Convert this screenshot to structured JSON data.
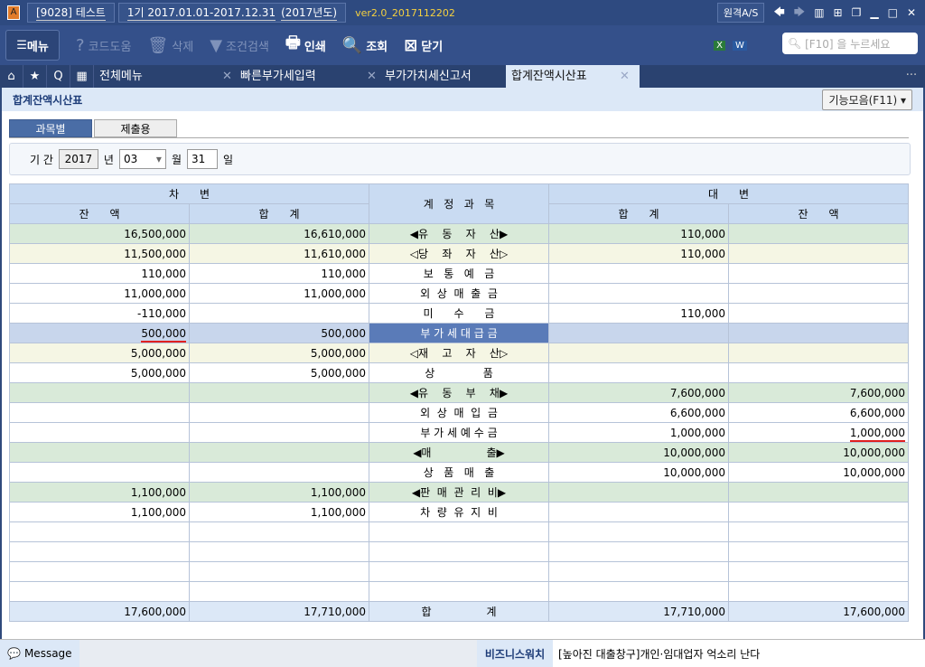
{
  "titlebar": {
    "app_icon": "A",
    "company": "[9028] 테스트",
    "period": "1기 2017.01.01-2017.12.31",
    "year": "(2017년도)",
    "version": "ver2.0_2017112202",
    "remote": "원격A/S"
  },
  "toolbar": {
    "menu": "메뉴",
    "help": "코드도움",
    "delete": "삭제",
    "filter": "조건검색",
    "print": "인쇄",
    "query": "조회",
    "close": "닫기",
    "search_placeholder": "[F10] 을 누르세요"
  },
  "tabs": {
    "all_menu": "전체메뉴",
    "items": [
      "빠른부가세입력",
      "부가가치세신고서",
      "합계잔액시산표"
    ],
    "more": "..."
  },
  "page": {
    "title": "합계잔액시산표",
    "function_menu": "기능모음(F11)",
    "subtabs": [
      "과목별",
      "제출용"
    ],
    "period_label": "기 간",
    "year": "2017",
    "year_unit": "년",
    "month": "03",
    "month_unit": "월",
    "day": "31",
    "day_unit": "일"
  },
  "table": {
    "debit": "차      변",
    "credit": "대      변",
    "account": "계   정   과   목",
    "balance": "잔      액",
    "total": "합      계",
    "rows": [
      {
        "t": "g",
        "d1": "16,500,000",
        "d2": "16,610,000",
        "a": "◀유    동    자    산▶",
        "c1": "110,000",
        "c2": ""
      },
      {
        "t": "y",
        "d1": "11,500,000",
        "d2": "11,610,000",
        "a": "◁당    좌    자    산▷",
        "c1": "110,000",
        "c2": ""
      },
      {
        "t": "w",
        "d1": "110,000",
        "d2": "110,000",
        "a": "보   통   예   금",
        "c1": "",
        "c2": ""
      },
      {
        "t": "w",
        "d1": "11,000,000",
        "d2": "11,000,000",
        "a": "외  상  매  출  금",
        "c1": "",
        "c2": ""
      },
      {
        "t": "w",
        "d1": "-110,000",
        "d2": "",
        "a": "미      수      금",
        "c1": "110,000",
        "c2": ""
      },
      {
        "t": "s",
        "d1": "500,000",
        "d2": "500,000",
        "a": "부 가 세 대 급 금",
        "c1": "",
        "c2": ""
      },
      {
        "t": "y",
        "d1": "5,000,000",
        "d2": "5,000,000",
        "a": "◁재    고    자    산▷",
        "c1": "",
        "c2": ""
      },
      {
        "t": "w",
        "d1": "5,000,000",
        "d2": "5,000,000",
        "a": "상              품",
        "c1": "",
        "c2": ""
      },
      {
        "t": "g",
        "d1": "",
        "d2": "",
        "a": "◀유    동    부    채▶",
        "c1": "7,600,000",
        "c2": "7,600,000"
      },
      {
        "t": "w",
        "d1": "",
        "d2": "",
        "a": "외  상  매  입  금",
        "c1": "6,600,000",
        "c2": "6,600,000"
      },
      {
        "t": "w",
        "d1": "",
        "d2": "",
        "a": "부 가 세 예 수 금",
        "c1": "1,000,000",
        "c2": "1,000,000"
      },
      {
        "t": "g",
        "d1": "",
        "d2": "",
        "a": "◀매                출▶",
        "c1": "10,000,000",
        "c2": "10,000,000"
      },
      {
        "t": "w",
        "d1": "",
        "d2": "",
        "a": "상   품   매   출",
        "c1": "10,000,000",
        "c2": "10,000,000"
      },
      {
        "t": "g",
        "d1": "1,100,000",
        "d2": "1,100,000",
        "a": "◀판  매  관  리  비▶",
        "c1": "",
        "c2": ""
      },
      {
        "t": "w",
        "d1": "1,100,000",
        "d2": "1,100,000",
        "a": "차  량  유  지  비",
        "c1": "",
        "c2": ""
      },
      {
        "t": "w",
        "d1": "",
        "d2": "",
        "a": "",
        "c1": "",
        "c2": ""
      },
      {
        "t": "w",
        "d1": "",
        "d2": "",
        "a": "",
        "c1": "",
        "c2": ""
      },
      {
        "t": "w",
        "d1": "",
        "d2": "",
        "a": "",
        "c1": "",
        "c2": ""
      },
      {
        "t": "w",
        "d1": "",
        "d2": "",
        "a": "",
        "c1": "",
        "c2": ""
      }
    ],
    "totals": {
      "d1": "17,600,000",
      "d2": "17,710,000",
      "a": "합                계",
      "c1": "17,710,000",
      "c2": "17,600,000"
    }
  },
  "status": {
    "message": "Message",
    "biz": "비즈니스워치",
    "news": "[높아진 대출창구]개인·임대업자 억소리 난다"
  }
}
